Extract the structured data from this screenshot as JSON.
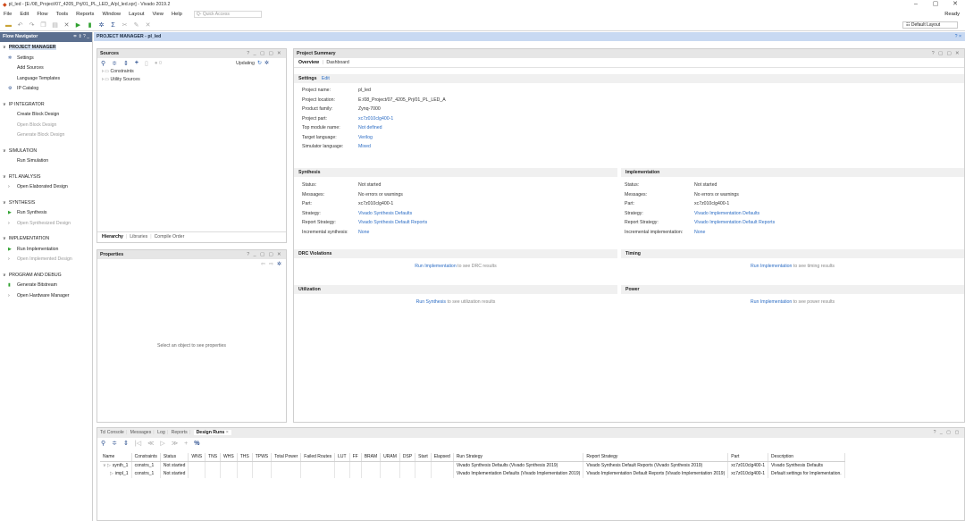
{
  "window": {
    "title": "pl_led - [E:/08_Project/07_4205_Prj/01_PL_LED_A/pl_led.xpr] - Vivado 2019.2",
    "controls": [
      "–",
      "▢",
      "✕"
    ]
  },
  "menu": {
    "items": [
      "File",
      "Edit",
      "Flow",
      "Tools",
      "Reports",
      "Window",
      "Layout",
      "View",
      "Help"
    ],
    "quick_access": "Q- Quick Access",
    "status": "Ready"
  },
  "toolbar": {
    "layout_select": "☷ Default Layout"
  },
  "flow_navigator": {
    "title": "Flow Navigator",
    "header_icons": "≑ ⇕ ? _",
    "sections": [
      {
        "name": "PROJECT MANAGER",
        "items": [
          {
            "label": "Settings",
            "icon": "gear-icon",
            "enabled": true
          },
          {
            "label": "Add Sources",
            "enabled": true
          },
          {
            "label": "Language Templates",
            "enabled": true
          },
          {
            "label": "IP Catalog",
            "icon": "ip-icon",
            "enabled": true
          }
        ]
      },
      {
        "name": "IP INTEGRATOR",
        "items": [
          {
            "label": "Create Block Design",
            "enabled": true
          },
          {
            "label": "Open Block Design",
            "enabled": false
          },
          {
            "label": "Generate Block Design",
            "enabled": false
          }
        ]
      },
      {
        "name": "SIMULATION",
        "items": [
          {
            "label": "Run Simulation",
            "enabled": true
          }
        ]
      },
      {
        "name": "RTL ANALYSIS",
        "items": [
          {
            "label": "Open Elaborated Design",
            "enabled": true,
            "expand": true
          }
        ]
      },
      {
        "name": "SYNTHESIS",
        "items": [
          {
            "label": "Run Synthesis",
            "icon": "play-icon",
            "enabled": true
          },
          {
            "label": "Open Synthesized Design",
            "enabled": false,
            "expand": true
          }
        ]
      },
      {
        "name": "IMPLEMENTATION",
        "items": [
          {
            "label": "Run Implementation",
            "icon": "play-icon",
            "enabled": true
          },
          {
            "label": "Open Implemented Design",
            "enabled": false,
            "expand": true
          }
        ]
      },
      {
        "name": "PROGRAM AND DEBUG",
        "items": [
          {
            "label": "Generate Bitstream",
            "icon": "bitstream-icon",
            "enabled": true
          },
          {
            "label": "Open Hardware Manager",
            "enabled": true,
            "expand": true
          }
        ]
      }
    ]
  },
  "project_manager_bar": {
    "title": "PROJECT MANAGER - pl_led",
    "help": "? ×"
  },
  "sources": {
    "title": "Sources",
    "controls": "? _ ▢ ▢ ✕",
    "status": "Updating",
    "count": "0",
    "tree": [
      "Constraints",
      "Utility Sources"
    ],
    "tabs": [
      "Hierarchy",
      "Libraries",
      "Compile Order"
    ],
    "active_tab": "Hierarchy"
  },
  "properties": {
    "title": "Properties",
    "controls": "? _ ▢ ▢ ✕",
    "empty_text": "Select an object to see properties"
  },
  "project_summary": {
    "title": "Project Summary",
    "controls": "? ▢ ▢ ✕",
    "tabs": [
      "Overview",
      "Dashboard"
    ],
    "settings_label": "Settings",
    "edit_label": "Edit",
    "settings": [
      {
        "k": "Project name:",
        "v": "pl_led",
        "link": false
      },
      {
        "k": "Project location:",
        "v": "E:/08_Project/07_4205_Prj/01_PL_LED_A",
        "link": false
      },
      {
        "k": "Product family:",
        "v": "Zynq-7000",
        "link": false
      },
      {
        "k": "Project part:",
        "v": "xc7z010clg400-1",
        "link": true
      },
      {
        "k": "Top module name:",
        "v": "Not defined",
        "link": true
      },
      {
        "k": "Target language:",
        "v": "Verilog",
        "link": true
      },
      {
        "k": "Simulator language:",
        "v": "Mixed",
        "link": true
      }
    ],
    "synthesis": {
      "title": "Synthesis",
      "rows": [
        {
          "k": "Status:",
          "v": "Not started",
          "link": false
        },
        {
          "k": "Messages:",
          "v": "No errors or warnings",
          "link": false
        },
        {
          "k": "Part:",
          "v": "xc7z010clg400-1",
          "link": false
        },
        {
          "k": "Strategy:",
          "v": "Vivado Synthesis Defaults",
          "link": true
        },
        {
          "k": "Report Strategy:",
          "v": "Vivado Synthesis Default Reports",
          "link": true
        },
        {
          "k": "Incremental synthesis:",
          "v": "None",
          "link": true
        }
      ]
    },
    "implementation": {
      "title": "Implementation",
      "rows": [
        {
          "k": "Status:",
          "v": "Not started",
          "link": false
        },
        {
          "k": "Messages:",
          "v": "No errors or warnings",
          "link": false
        },
        {
          "k": "Part:",
          "v": "xc7z010clg400-1",
          "link": false
        },
        {
          "k": "Strategy:",
          "v": "Vivado Implementation Defaults",
          "link": true
        },
        {
          "k": "Report Strategy:",
          "v": "Vivado Implementation Default Reports",
          "link": true
        },
        {
          "k": "Incremental implementation:",
          "v": "None",
          "link": true
        }
      ]
    },
    "drc": {
      "title": "DRC Violations",
      "link": "Run Implementation",
      "text": "to see DRC results"
    },
    "timing": {
      "title": "Timing",
      "link": "Run Implementation",
      "text": "to see timing results"
    },
    "utilization": {
      "title": "Utilization",
      "link": "Run Synthesis",
      "text": "to see utilization results"
    },
    "power": {
      "title": "Power",
      "link": "Run Implementation",
      "text": "to see power results"
    }
  },
  "bottom": {
    "tabs": [
      "Tcl Console",
      "Messages",
      "Log",
      "Reports",
      "Design Runs"
    ],
    "active_tab": "Design Runs",
    "close": "×",
    "controls": "? _ ▢ ▢",
    "columns": [
      "Name",
      "Constraints",
      "Status",
      "WNS",
      "TNS",
      "WHS",
      "THS",
      "TPWS",
      "Total Power",
      "Failed Routes",
      "LUT",
      "FF",
      "BRAM",
      "URAM",
      "DSP",
      "Start",
      "Elapsed",
      "Run Strategy",
      "Report Strategy",
      "Part",
      "Description"
    ],
    "rows": [
      {
        "name": "synth_1",
        "tree": "∨ ▷",
        "constraints": "constrs_1",
        "status": "Not started",
        "run_strategy": "Vivado Synthesis Defaults (Vivado Synthesis 2019)",
        "report_strategy": "Vivado Synthesis Default Reports (Vivado Synthesis 2019)",
        "part": "xc7z010clg400-1",
        "description": "Vivado Synthesis Defaults"
      },
      {
        "name": "impl_1",
        "tree": "▷",
        "constraints": "constrs_1",
        "status": "Not started",
        "run_strategy": "Vivado Implementation Defaults (Vivado Implementation 2019)",
        "report_strategy": "Vivado Implementation Default Reports (Vivado Implementation 2019)",
        "part": "xc7z010clg400-1",
        "description": "Default settings for Implementation."
      }
    ]
  }
}
